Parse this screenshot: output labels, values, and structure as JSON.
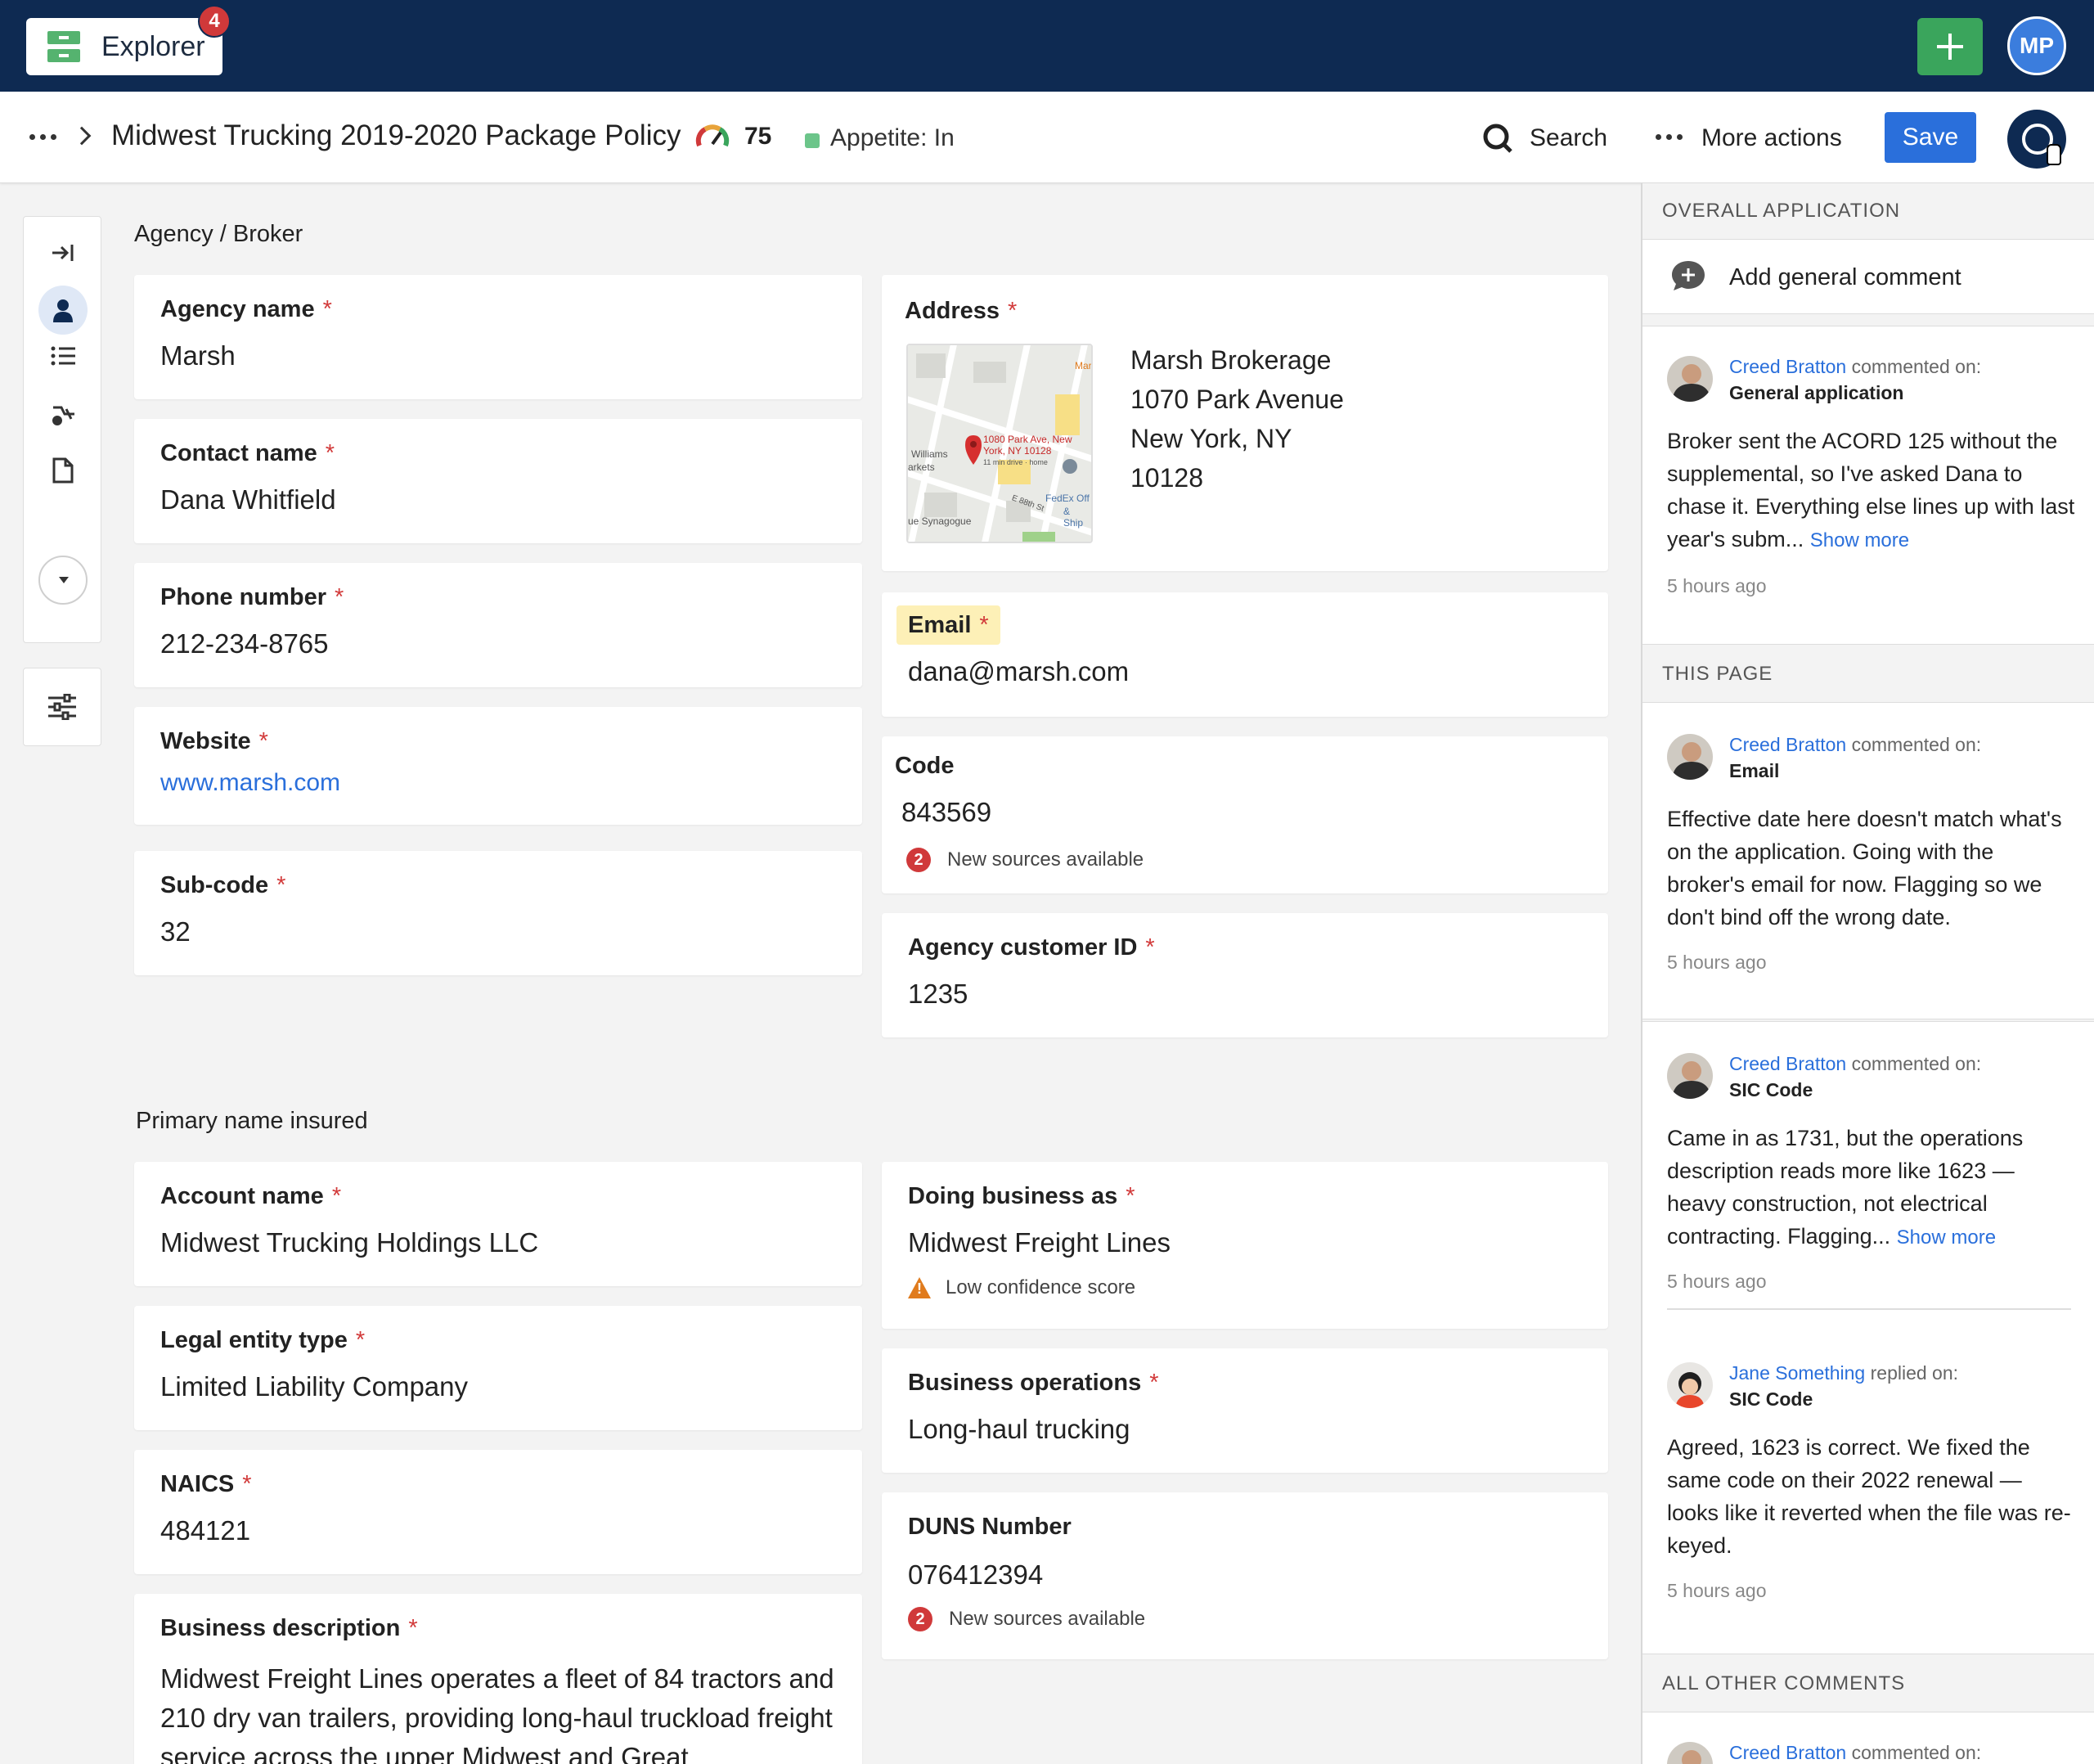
{
  "topbar": {
    "explorer_label": "Explorer",
    "explorer_badge": "4",
    "user_initials": "MP"
  },
  "header": {
    "title": "Midwest Trucking 2019-2020 Package Policy",
    "score": "75",
    "appetite": "Appetite: In",
    "search_label": "Search",
    "more_actions_label": "More actions",
    "save_label": "Save"
  },
  "agency": {
    "heading": "Agency / Broker",
    "agency_name": {
      "label": "Agency name",
      "value": "Marsh"
    },
    "contact_name": {
      "label": "Contact name",
      "value": "Dana Whitfield"
    },
    "phone": {
      "label": "Phone number",
      "value": "212-234-8765"
    },
    "website": {
      "label": "Website",
      "value": "www.marsh.com"
    },
    "subcode": {
      "label": "Sub-code",
      "value": "32"
    },
    "address": {
      "label": "Address",
      "lines": [
        "Marsh Brokerage",
        "1070 Park Avenue",
        "New York, NY",
        "10128"
      ],
      "map_pin_text": "1080 Park Ave, New York, NY 10128",
      "map_pin_sub": "11 min drive · home",
      "map_labels": [
        "Williams",
        "arkets",
        "FedEx Off",
        "& Ship",
        "ue Synagogue",
        "Mar",
        "E 88th St"
      ]
    },
    "email": {
      "label": "Email",
      "value": "dana@marsh.com"
    },
    "code": {
      "label": "Code",
      "value": "843569",
      "note": "New sources available",
      "note_count": "2"
    },
    "agency_customer_id": {
      "label": "Agency customer ID",
      "value": "1235"
    }
  },
  "insured": {
    "heading": "Primary name insured",
    "account_name": {
      "label": "Account name",
      "value": "Midwest Trucking Holdings LLC"
    },
    "dba": {
      "label": "Doing business as",
      "value": "Midwest Freight Lines",
      "note": "Low confidence score"
    },
    "legal_entity": {
      "label": "Legal entity type",
      "value": "Limited Liability Company"
    },
    "business_operations": {
      "label": "Business operations",
      "value": "Long-haul trucking"
    },
    "naics": {
      "label": "NAICS",
      "value": "484121"
    },
    "duns": {
      "label": "DUNS Number",
      "value": "076412394",
      "note": "New sources available",
      "note_count": "2"
    },
    "business_description": {
      "label": "Business description",
      "value": "Midwest Freight Lines operates a fleet of 84 tractors and 210 dry van trailers, providing long-haul truckload freight service across the upper Midwest and Great"
    }
  },
  "comments": {
    "overall_heading": "OVERALL APPLICATION",
    "add_comment_label": "Add general comment",
    "this_page_heading": "THIS PAGE",
    "all_other_heading": "ALL OTHER COMMENTS",
    "show_more": "Show more",
    "items": [
      {
        "author": "Creed Bratton",
        "action": "commented on:",
        "target": "General application",
        "body": "Broker sent the ACORD 125 without the supplemental, so I've asked Dana to chase it. Everything else lines up with last year's subm...",
        "time": "5 hours ago"
      },
      {
        "author": "Creed Bratton",
        "action": "commented on:",
        "target": "Email",
        "body": "Effective date here doesn't match what's on the application. Going with the broker's email for now. Flagging so we don't bind off the wrong date.",
        "time": "5 hours ago"
      },
      {
        "author": "Creed Bratton",
        "action": "commented on:",
        "target": "SIC Code",
        "body": "Came in as 1731, but the operations description reads more like 1623 — heavy construction, not electrical contracting. Flagging...",
        "time": "5 hours ago"
      },
      {
        "author": "Jane Something",
        "action": "replied on:",
        "target": "SIC Code",
        "body": "Agreed, 1623 is correct. We fixed the same code on their 2022 renewal — looks like it reverted when the file was re-keyed.",
        "time": "5 hours ago"
      },
      {
        "author": "Creed Bratton",
        "action": "commented on:"
      }
    ]
  }
}
